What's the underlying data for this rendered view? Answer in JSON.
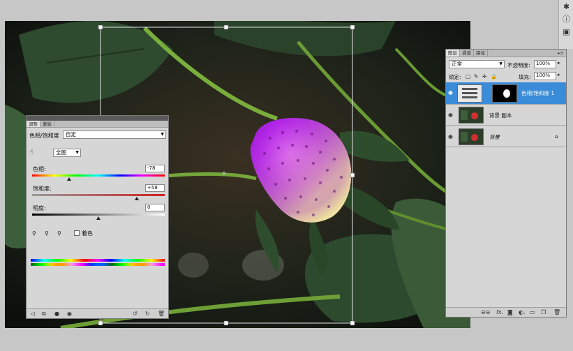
{
  "adjustments": {
    "tabs": [
      "调整",
      "蒙版"
    ],
    "title": "色相/饱和度",
    "preset": "自定",
    "channel": "全图",
    "hue_label": "色相:",
    "hue_value": "-78",
    "hue_level": 0.28,
    "sat_label": "饱和度:",
    "sat_value": "+58",
    "sat_level": 0.79,
    "light_label": "明度:",
    "light_value": "0",
    "light_level": 0.5,
    "colorize_label": "着色"
  },
  "layers": {
    "tabs": [
      "图层",
      "通道",
      "路径"
    ],
    "blend_mode": "正常",
    "opacity_label": "不透明度:",
    "opacity_value": "100%",
    "lock_label": "锁定:",
    "fill_label": "填充:",
    "fill_value": "100%",
    "items": [
      {
        "name": "色相/饱和度 1"
      },
      {
        "name": "背景 副本"
      },
      {
        "name": "背景"
      }
    ]
  },
  "colors": {
    "selected_layer": "#3a8cd9",
    "panel_bg": "#d6d6d6",
    "strawberry": "#b020e8"
  },
  "icons": [
    "star-icon",
    "info-icon",
    "image-icon",
    "eye-icon",
    "lock-icon",
    "eyedropper-icon",
    "hand-adjust-icon"
  ]
}
